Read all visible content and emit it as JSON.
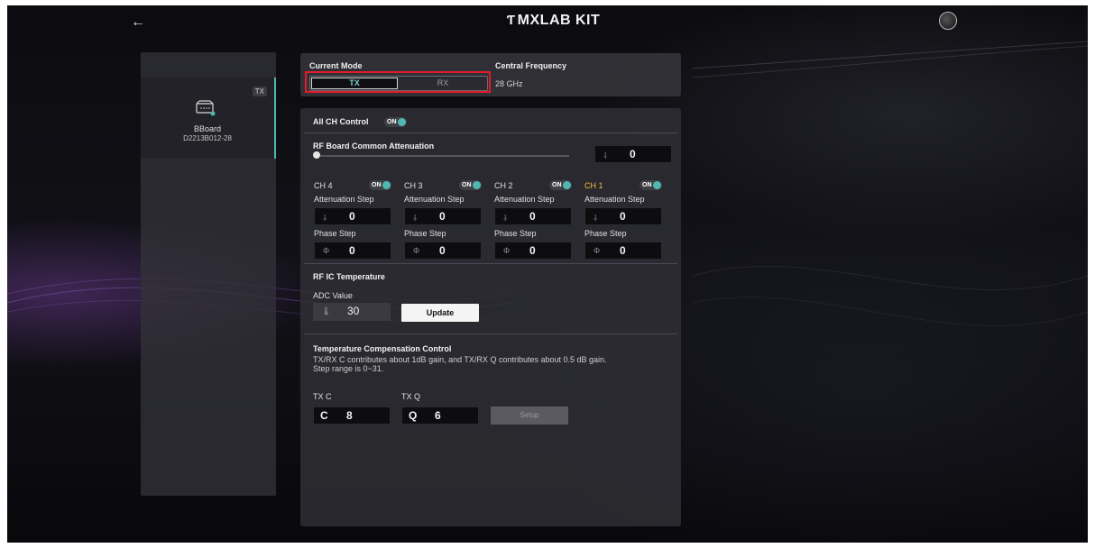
{
  "header": {
    "brand_mark": "Ƭ",
    "brand_name": "MXLAB KIT"
  },
  "sidebar": {
    "device": {
      "badge": "TX",
      "name": "BBoard",
      "id": "D2213B012-28"
    }
  },
  "mode_panel": {
    "current_mode_label": "Current Mode",
    "modes": [
      "TX",
      "RX"
    ],
    "selected_mode": "TX",
    "central_frequency_label": "Central Frequency",
    "central_frequency_value": "28 GHz"
  },
  "all_ch_control": {
    "label": "All CH Control",
    "toggle": "ON"
  },
  "common_attenuation": {
    "label": "RF Board Common Attenuation",
    "value": "0",
    "slider_fraction": 0
  },
  "channels": [
    {
      "name": "CH 4",
      "toggle": "ON",
      "attenuation_label": "Attenuation Step",
      "attenuation": "0",
      "phase_label": "Phase Step",
      "phase": "0",
      "highlight": false
    },
    {
      "name": "CH 3",
      "toggle": "ON",
      "attenuation_label": "Attenuation Step",
      "attenuation": "0",
      "phase_label": "Phase Step",
      "phase": "0",
      "highlight": false
    },
    {
      "name": "CH 2",
      "toggle": "ON",
      "attenuation_label": "Attenuation Step",
      "attenuation": "0",
      "phase_label": "Phase Step",
      "phase": "0",
      "highlight": false
    },
    {
      "name": "CH 1",
      "toggle": "ON",
      "attenuation_label": "Attenuation Step",
      "attenuation": "0",
      "phase_label": "Phase Step",
      "phase": "0",
      "highlight": true
    }
  ],
  "temperature": {
    "section_label": "RF IC Temperature",
    "adc_label": "ADC Value",
    "adc_value": "30",
    "update_label": "Update"
  },
  "compensation": {
    "section_label": "Temperature Compensation Control",
    "description_line1": "TX/RX C contributes about 1dB gain, and TX/RX Q contributes about 0.5 dB gain.",
    "description_line2": "Step range is 0~31.",
    "txc_label": "TX C",
    "txc_prefix": "C",
    "txc_value": "8",
    "txq_label": "TX Q",
    "txq_prefix": "Q",
    "txq_value": "6",
    "setup_label": "Setup"
  },
  "icons": {
    "attenuation_prefix": "⸸",
    "phase_prefix": "Φ",
    "thermometer_prefix": "🌡"
  },
  "colors": {
    "accent_teal": "#4fb8b0",
    "highlight_red": "#e21c2a",
    "ch1_yellow": "#f0c040"
  }
}
